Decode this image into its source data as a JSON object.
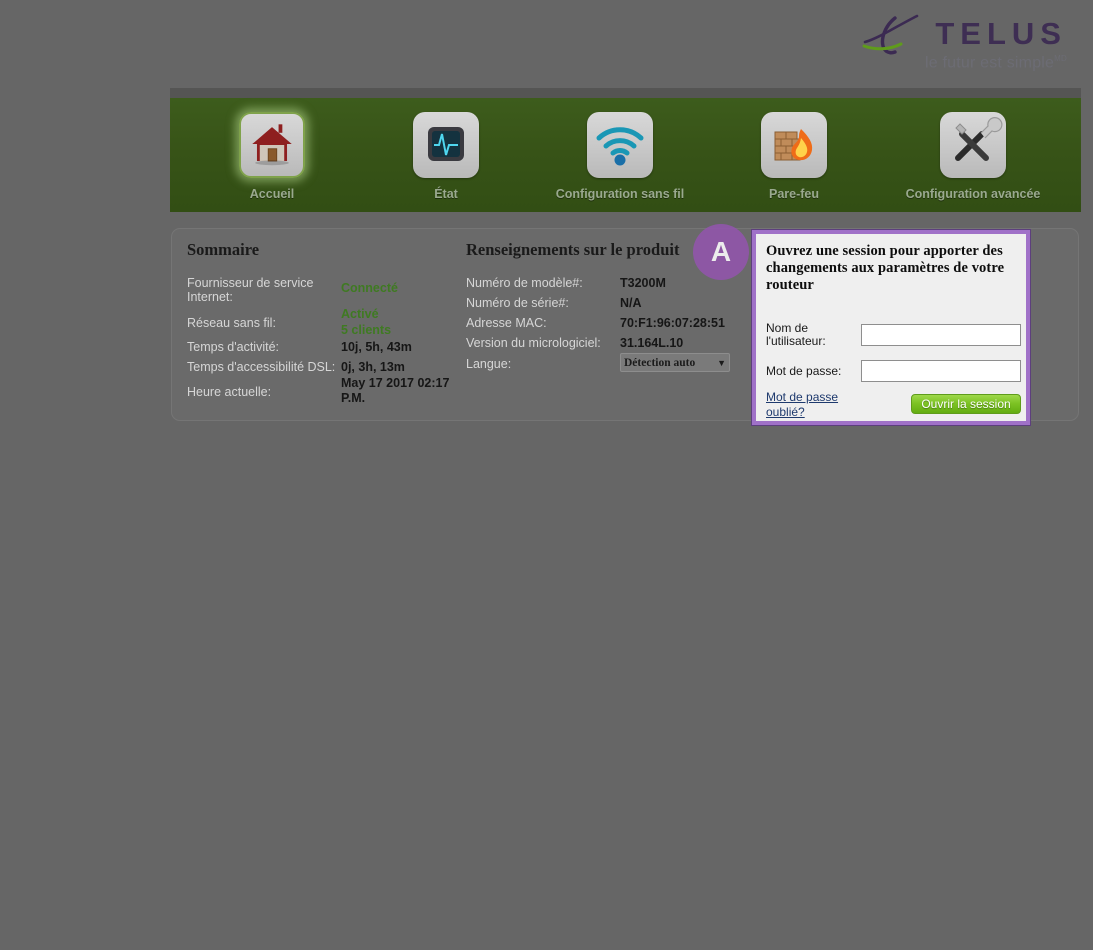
{
  "brand": {
    "name": "TELUS",
    "tagline": "le futur est simple",
    "tagline_sup": "MD",
    "logo_icon": "telus-bird-icon"
  },
  "nav": {
    "items": [
      {
        "label": "Accueil",
        "icon": "home-icon",
        "active": true
      },
      {
        "label": "État",
        "icon": "monitor-pulse-icon",
        "active": false
      },
      {
        "label": "Configuration sans fil",
        "icon": "wifi-icon",
        "active": false
      },
      {
        "label": "Pare-feu",
        "icon": "firewall-brick-flame-icon",
        "active": false
      },
      {
        "label": "Configuration avancée",
        "icon": "tools-icon",
        "active": false
      }
    ]
  },
  "summary": {
    "title": "Sommaire",
    "rows": [
      {
        "label": "Fournisseur de service Internet:",
        "value": "Connecté",
        "style": "green"
      },
      {
        "label": "Réseau sans fil:",
        "value": "Activé",
        "value2": "5 clients",
        "style": "green"
      },
      {
        "label": "Temps d'activité:",
        "value": "10j, 5h, 43m",
        "style": "normal"
      },
      {
        "label": "Temps d'accessibilité DSL:",
        "value": "0j, 3h, 13m",
        "style": "normal"
      },
      {
        "label": "Heure actuelle:",
        "value": "May 17 2017 02:17 P.M.",
        "style": "normal"
      }
    ]
  },
  "product": {
    "title": "Renseignements sur le produit",
    "rows": [
      {
        "label": "Numéro de modèle#:",
        "value": "T3200M"
      },
      {
        "label": "Numéro de série#:",
        "value": "N/A"
      },
      {
        "label": "Adresse MAC:",
        "value": "70:F1:96:07:28:51"
      },
      {
        "label": "Version du micrologiciel:",
        "value": "31.164L.10"
      }
    ],
    "language_label": "Langue:",
    "language_selected": "Détection auto",
    "language_caret": "▼"
  },
  "login": {
    "title": "Ouvrez une session pour apporter des changements aux paramètres de votre routeur",
    "username_label": "Nom de l'utilisateur:",
    "username_value": "",
    "username_placeholder": "",
    "password_label": "Mot de passe:",
    "password_value": "",
    "password_placeholder": "",
    "forgot_label": "Mot de passe oublié?",
    "submit_label": "Ouvrir la session"
  },
  "annotation": {
    "badge_letter": "A",
    "badge_color": "#9255ad"
  },
  "colors": {
    "page_background": "#666666",
    "nav_green": "#375317",
    "status_green": "#3f7a22",
    "highlight_purple": "#a071c8",
    "link_blue": "#1e3a6e",
    "button_green": "#7cc223"
  }
}
